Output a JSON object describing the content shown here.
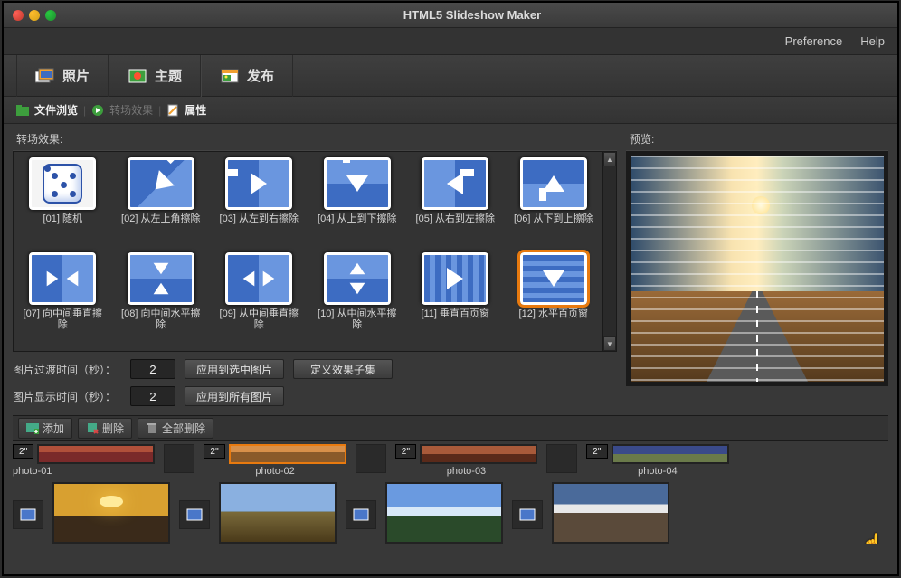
{
  "window": {
    "title": "HTML5 Slideshow Maker"
  },
  "menubar": {
    "preference": "Preference",
    "help": "Help"
  },
  "mainTabs": {
    "photo": "照片",
    "theme": "主题",
    "publish": "发布"
  },
  "subTabs": {
    "fileBrowse": "文件浏览",
    "transition": "转场效果",
    "properties": "属性"
  },
  "panels": {
    "effectsTitle": "转场效果:",
    "previewTitle": "预览:"
  },
  "effects": [
    {
      "label": "[01] 随机"
    },
    {
      "label": "[02] 从左上角擦除"
    },
    {
      "label": "[03] 从左到右擦除"
    },
    {
      "label": "[04] 从上到下擦除"
    },
    {
      "label": "[05] 从右到左擦除"
    },
    {
      "label": "[06] 从下到上擦除"
    },
    {
      "label": "[07] 向中间垂直擦除"
    },
    {
      "label": "[08] 向中间水平擦除"
    },
    {
      "label": "[09] 从中间垂直擦除"
    },
    {
      "label": "[10] 从中间水平擦除"
    },
    {
      "label": "[11] 垂直百页窗"
    },
    {
      "label": "[12] 水平百页窗"
    }
  ],
  "selectedEffectIndex": 11,
  "controls": {
    "transTimeLabel": "图片过渡时间（秒）：",
    "transTimeValue": "2",
    "applySelected": "应用到选中图片",
    "defineSubset": "定义效果子集",
    "showTimeLabel": "图片显示时间（秒）：",
    "showTimeValue": "2",
    "applyAll": "应用到所有图片"
  },
  "toolbar": {
    "add": "添加",
    "delete": "删除",
    "deleteAll": "全部删除"
  },
  "strip": {
    "duration": "2''",
    "photos": [
      {
        "name": "photo-01"
      },
      {
        "name": "photo-02",
        "selected": true
      },
      {
        "name": "photo-03"
      },
      {
        "name": "photo-04"
      }
    ]
  }
}
